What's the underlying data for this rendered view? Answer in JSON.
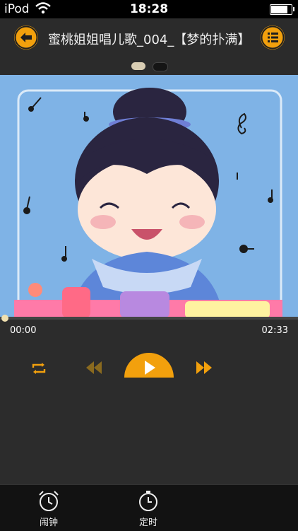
{
  "status_bar": {
    "carrier": "iPod",
    "time": "18:28",
    "battery_level": 0.9,
    "icons": [
      "wifi-icon",
      "battery-icon"
    ]
  },
  "nav": {
    "title": "蜜桃姐姐唱儿歌_004_【梦的扑满】",
    "back_icon": "arrow-left-icon",
    "list_icon": "list-icon"
  },
  "pager": {
    "pages": 2,
    "active": 0
  },
  "player": {
    "elapsed": "00:00",
    "duration": "02:33",
    "progress": 0.0,
    "controls": [
      "repeat-icon",
      "previous-icon",
      "play-icon",
      "next-icon"
    ]
  },
  "tabs": [
    {
      "label": "闹钟",
      "icon": "alarm-clock-icon"
    },
    {
      "label": "定时",
      "icon": "timer-icon"
    }
  ],
  "colors": {
    "accent": "#f2a00d",
    "background": "#2c2c2c",
    "video_bg": "#7fb3e6"
  }
}
